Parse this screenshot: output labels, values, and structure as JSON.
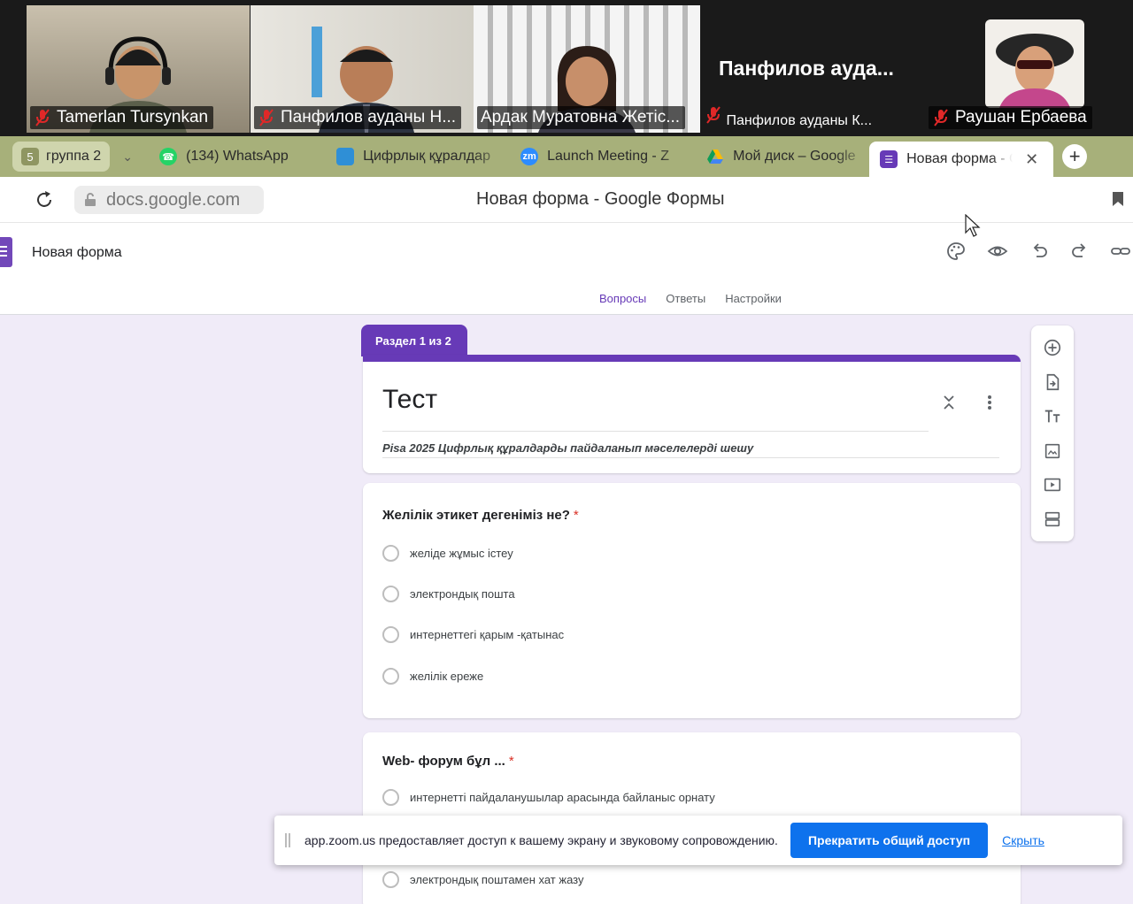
{
  "zoom": {
    "participants": [
      {
        "name": "Tamerlan Tursynkan"
      },
      {
        "name": "Панфилов ауданы Н..."
      },
      {
        "name": "Ардак Муратовна Жетіс..."
      },
      {
        "name": "Панфилов ауданы К..."
      },
      {
        "name": "Раушан Ербаева"
      }
    ],
    "name_only_tile": "Панфилов  ауда..."
  },
  "browser": {
    "group_count": "5",
    "group_name": "группа 2",
    "tabs": [
      {
        "label": "(134) WhatsApp"
      },
      {
        "label": "Цифрлық құралдар"
      },
      {
        "label": "Launch Meeting - Z"
      },
      {
        "label": "Мой диск – Google"
      },
      {
        "label": "Новая форма - G"
      }
    ],
    "url": "docs.google.com",
    "page_title": "Новая форма - Google Формы"
  },
  "forms": {
    "doc_title": "Новая форма",
    "tabs": [
      "Вопросы",
      "Ответы",
      "Настройки"
    ],
    "section_label": "Раздел 1 из 2",
    "form_title": "Тест",
    "form_description": "Pisa 2025 Цифрлық құралдарды пайдаланып мәселелерді шешу",
    "questions": [
      {
        "title": "Желілік этикет дегеніміз не?",
        "required": "*",
        "options": [
          "желіде жұмыс істеу",
          "электрондық пошта",
          "интернеттегі қарым -қатынас",
          "желілік ереже"
        ]
      },
      {
        "title": "Web- форум бұл ...",
        "required": "*",
        "options": [
          "интернетті пайдаланушылар арасында байланыс орнату",
          "электрондық поштамен хат жазу"
        ]
      }
    ]
  },
  "share_banner": {
    "message": "app.zoom.us предоставляет доступ к вашему экрану и звуковому сопровождению.",
    "stop_label": "Прекратить общий доступ",
    "hide_label": "Скрыть"
  },
  "colors": {
    "forms_accent": "#673ab7",
    "zoom_blue": "#0e72ed",
    "active_speaker": "#23d967",
    "tabbar": "#a7b07a"
  }
}
